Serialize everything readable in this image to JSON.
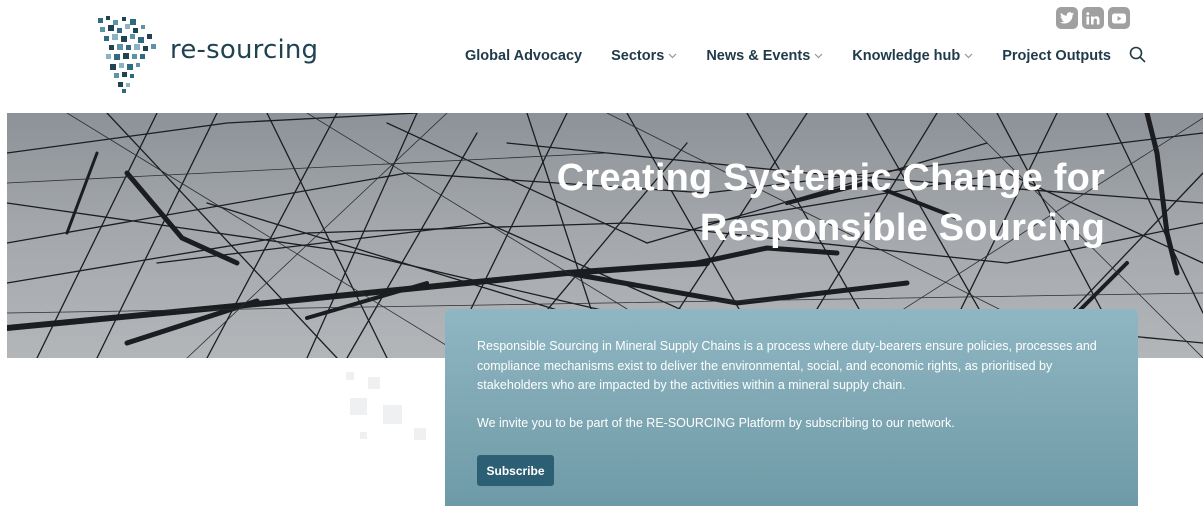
{
  "brand": {
    "name": "re-sourcing"
  },
  "social": [
    {
      "icon": "twitter-icon",
      "label": "Twitter"
    },
    {
      "icon": "linkedin-icon",
      "label": "LinkedIn"
    },
    {
      "icon": "youtube-icon",
      "label": "YouTube"
    }
  ],
  "nav": {
    "items": [
      {
        "label": "Global Advocacy",
        "has_dropdown": false
      },
      {
        "label": "Sectors",
        "has_dropdown": true
      },
      {
        "label": "News & Events",
        "has_dropdown": true
      },
      {
        "label": "Knowledge hub",
        "has_dropdown": true
      },
      {
        "label": "Project Outputs",
        "has_dropdown": false
      }
    ],
    "search_icon": "search-icon"
  },
  "hero": {
    "title_line1": "Creating Systemic Change for",
    "title_line2": "Responsible Sourcing"
  },
  "card": {
    "paragraph1": "Responsible Sourcing in Mineral Supply Chains is a process where duty-bearers ensure policies, processes and compliance mechanisms exist to deliver the environmental, social, and economic rights, as prioritised by stakeholders who are impacted by the activities within a mineral supply chain.",
    "paragraph2": "We invite you to be part of the RE-SOURCING Platform by subscribing to our network.",
    "button_label": "Subscribe"
  },
  "colors": {
    "nav_text": "#1f3a48",
    "logo_text": "#1f4350",
    "card_bg": "#7fa8b4",
    "button_bg": "#2c5f74",
    "social_bg": "#a0a0a0"
  }
}
